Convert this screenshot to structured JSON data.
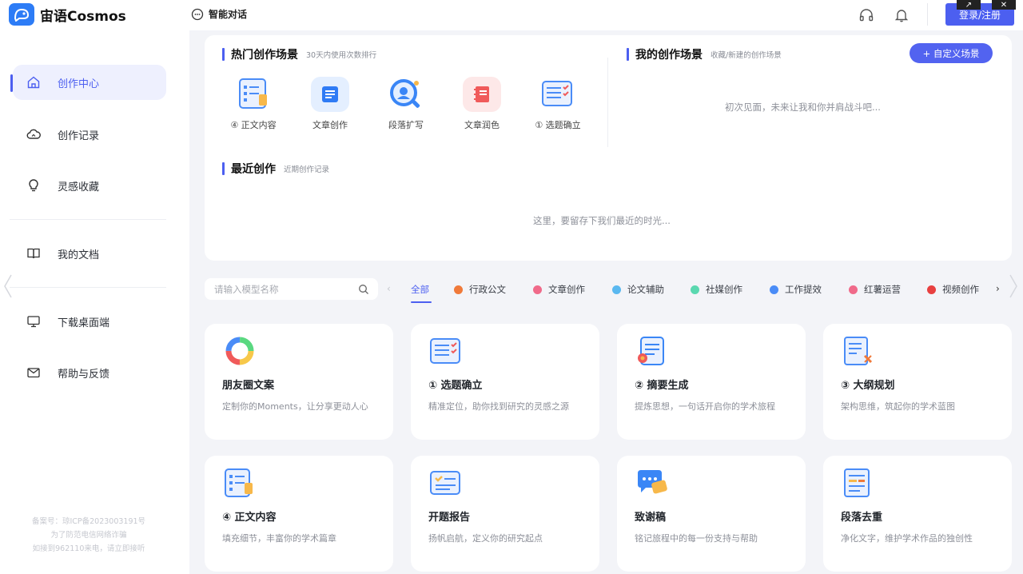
{
  "app": {
    "brand": "宙语Cosmos",
    "chat_label": "智能对话",
    "login_label": "登录/注册"
  },
  "colors": {
    "accent": "#4c5ff0",
    "background": "#f3f4f8"
  },
  "sidebar": {
    "items": [
      {
        "label": "创作中心",
        "icon": "home-icon",
        "active": true
      },
      {
        "label": "创作记录",
        "icon": "cloud-icon"
      },
      {
        "label": "灵感收藏",
        "icon": "lightbulb-icon"
      },
      {
        "label": "我的文档",
        "icon": "book-icon"
      },
      {
        "label": "下载桌面端",
        "icon": "monitor-icon"
      },
      {
        "label": "帮助与反馈",
        "icon": "mail-icon"
      }
    ],
    "footer": [
      "备案号：琼ICP备2023003191号",
      "为了防范电信网络诈骗",
      "如接到962110来电，请立即接听"
    ]
  },
  "hot": {
    "title": "热门创作场景",
    "subtitle": "30天内使用次数排行",
    "items": [
      {
        "label": "④ 正文内容",
        "icon": "document-list-icon",
        "color": "#4a8cf7"
      },
      {
        "label": "文章创作",
        "icon": "article-icon",
        "color": "#2f7bf5"
      },
      {
        "label": "段落扩写",
        "icon": "magnify-icon",
        "color": "#3a86f6"
      },
      {
        "label": "文章润色",
        "icon": "notebook-icon",
        "color": "#f05a5a"
      },
      {
        "label": "① 选题确立",
        "icon": "checklist-icon",
        "color": "#4a8cf7"
      }
    ]
  },
  "mine": {
    "title": "我的创作场景",
    "subtitle": "收藏/新建的创作场景",
    "button": "+ 自定义场景",
    "empty": "初次见面，未来让我和你并肩战斗吧..."
  },
  "recent": {
    "title": "最近创作",
    "subtitle": "近期创作记录",
    "empty": "这里，要留存下我们最近的时光..."
  },
  "filter": {
    "placeholder": "请输入模型名称",
    "categories": [
      {
        "label": "全部",
        "active": true
      },
      {
        "label": "行政公文",
        "color": "#f07a3a"
      },
      {
        "label": "文章创作",
        "color": "#f06a8a"
      },
      {
        "label": "论文辅助",
        "color": "#5ab8f0"
      },
      {
        "label": "社媒创作",
        "color": "#5ad8b0"
      },
      {
        "label": "工作提效",
        "color": "#4a8cf7"
      },
      {
        "label": "红薯运营",
        "color": "#f06a8a"
      },
      {
        "label": "视频创作",
        "color": "#e84040"
      }
    ]
  },
  "cards": [
    {
      "title": "朋友圈文案",
      "desc": "定制你的Moments，让分享更动人心",
      "icon": "ring-icon"
    },
    {
      "title": "① 选题确立",
      "desc": "精准定位，助你找到研究的灵感之源",
      "icon": "checklist-icon"
    },
    {
      "title": "② 摘要生成",
      "desc": "提炼思想，一句话开启你的学术旅程",
      "icon": "summary-icon"
    },
    {
      "title": "③ 大纲规划",
      "desc": "架构思维，筑起你的学术蓝图",
      "icon": "outline-icon"
    },
    {
      "title": "④ 正文内容",
      "desc": "填充细节，丰富你的学术篇章",
      "icon": "document-list-icon"
    },
    {
      "title": "开题报告",
      "desc": "扬帆启航，定义你的研究起点",
      "icon": "report-icon"
    },
    {
      "title": "致谢稿",
      "desc": "铭记旅程中的每一份支持与帮助",
      "icon": "chat-bubble-icon"
    },
    {
      "title": "段落去重",
      "desc": "净化文字，维护学术作品的独创性",
      "icon": "dedupe-icon"
    }
  ]
}
